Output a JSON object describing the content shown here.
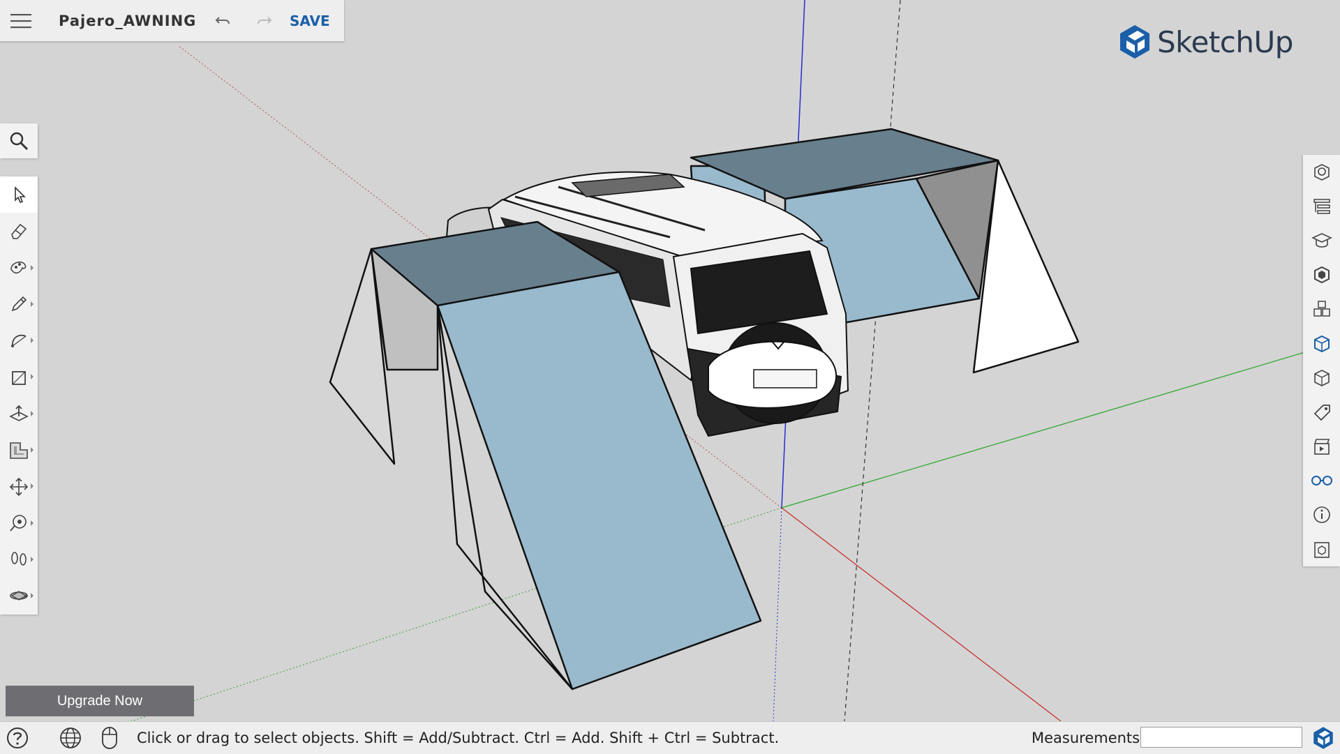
{
  "app": {
    "name": "SketchUp",
    "document_title": "Pajero_AWNING",
    "save_label": "SAVE",
    "accent_color": "#1a5fa8"
  },
  "left_toolbar": {
    "search": "search-icon",
    "tools": [
      {
        "name": "select",
        "icon": "arrow-cursor-icon",
        "active": true
      },
      {
        "name": "eraser",
        "icon": "eraser-icon"
      },
      {
        "name": "paint-bucket",
        "icon": "paint-icon"
      },
      {
        "name": "line",
        "icon": "pencil-icon"
      },
      {
        "name": "arc",
        "icon": "arc-icon"
      },
      {
        "name": "rectangle",
        "icon": "rectangle-icon"
      },
      {
        "name": "push-pull",
        "icon": "push-pull-icon"
      },
      {
        "name": "offset",
        "icon": "offset-icon"
      },
      {
        "name": "move",
        "icon": "move-icon"
      },
      {
        "name": "tape-measure",
        "icon": "tape-measure-icon"
      },
      {
        "name": "walk",
        "icon": "footprints-icon"
      },
      {
        "name": "orbit",
        "icon": "orbit-icon"
      }
    ]
  },
  "right_panel": {
    "icons": [
      "entity-info-icon",
      "outliner-icon",
      "instructor-icon",
      "materials-icon",
      "components-icon",
      "solid-tools-icon",
      "styles-icon",
      "tags-icon",
      "scenes-icon",
      "display-icon",
      "model-info-icon",
      "3d-warehouse-icon"
    ]
  },
  "upgrade": {
    "label": "Upgrade Now"
  },
  "statusbar": {
    "message": "Click or drag to select objects. Shift = Add/Subtract. Ctrl = Add. Shift + Ctrl = Subtract.",
    "measurements_label": "Measurements",
    "measurements_value": ""
  },
  "scene": {
    "background_color": "#d4d4d4",
    "awning_top_color": "#687f8d",
    "awning_face_color": "#99bacd",
    "awning_side_color": "#c8c8c8",
    "axis_red": "#c83030",
    "axis_green": "#2fa82f",
    "axis_blue": "#2a2ad0"
  }
}
